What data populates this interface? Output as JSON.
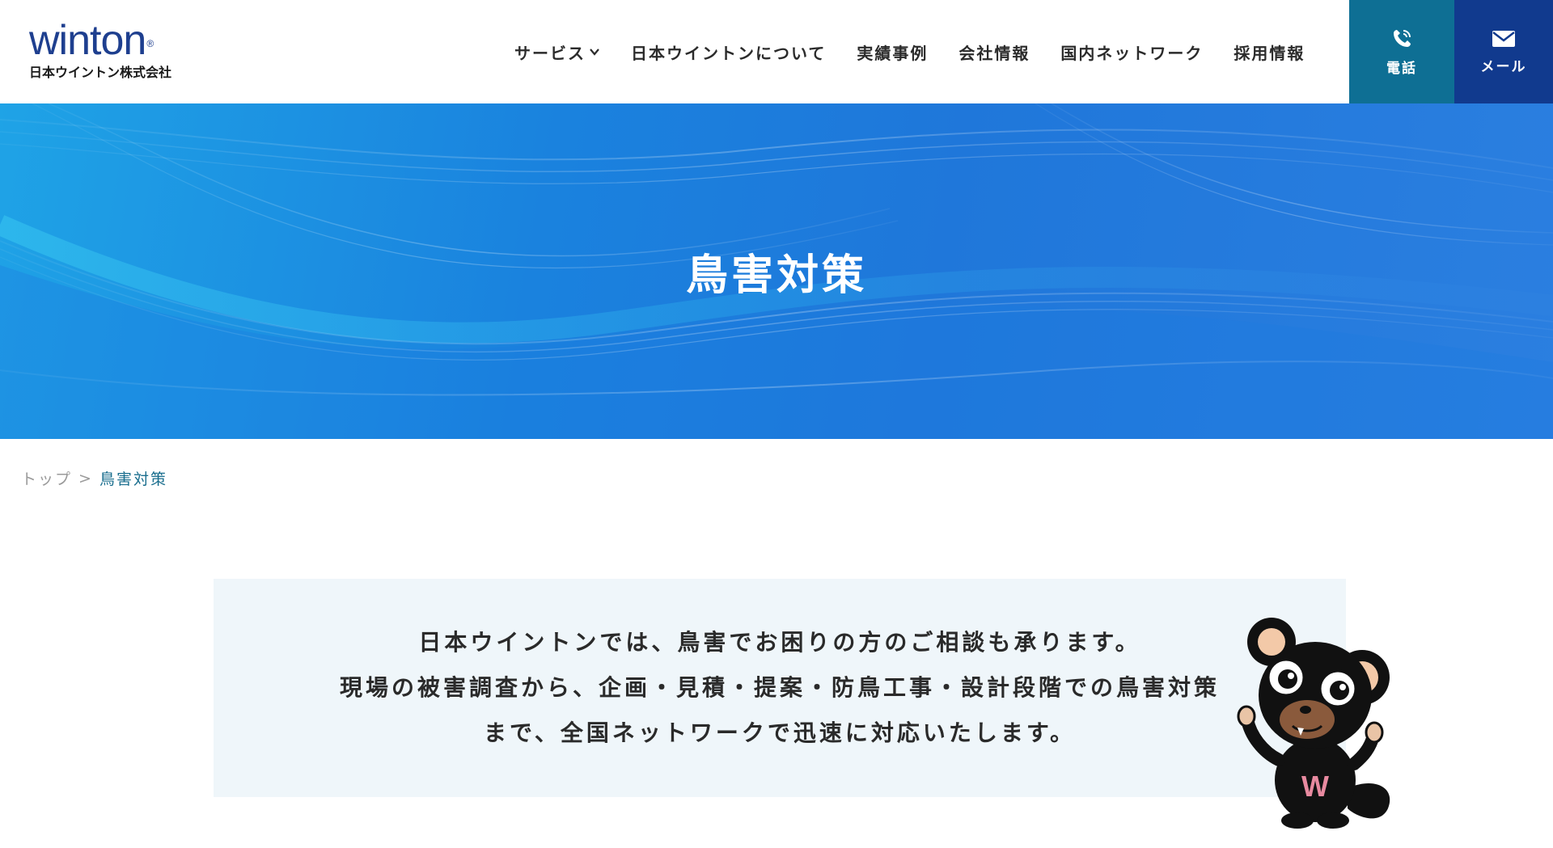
{
  "header": {
    "logo_wordmark": "winton",
    "logo_reg": "®",
    "logo_sub": "日本ウイントン株式会社",
    "nav": [
      {
        "label": "サービス",
        "has_dropdown": true
      },
      {
        "label": "日本ウイントンについて"
      },
      {
        "label": "実績事例"
      },
      {
        "label": "会社情報"
      },
      {
        "label": "国内ネットワーク"
      },
      {
        "label": "採用情報"
      }
    ],
    "tel_label": "電話",
    "mail_label": "メール",
    "tel_icon": "phone-icon",
    "mail_icon": "envelope-icon",
    "colors": {
      "tel_bg": "#0e6f94",
      "mail_bg": "#113a8e",
      "brand": "#1e3f8f"
    }
  },
  "hero": {
    "title": "鳥害対策",
    "bg_color": "#1f7fdc"
  },
  "breadcrumb": {
    "home": "トップ",
    "separator": ">",
    "current": "鳥害対策"
  },
  "intro": {
    "lines": [
      "日本ウイントンでは、鳥害でお困りの方のご相談も承ります。",
      "現場の被害調査から、企画・見積・提案・防鳥工事・設計段階での鳥害対策",
      "まで、全国ネットワークで迅速に対応いたします。"
    ],
    "mascot_letter": "W"
  }
}
